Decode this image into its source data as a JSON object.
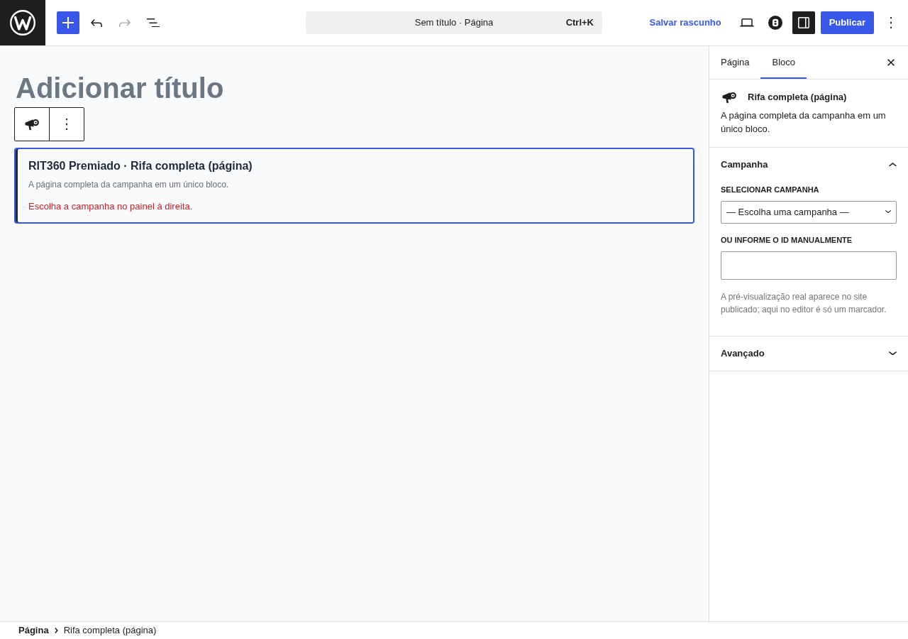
{
  "header": {
    "tools": [
      {
        "kind": "add",
        "disabled": false
      },
      {
        "kind": "undo",
        "disabled": false
      },
      {
        "kind": "redo",
        "disabled": true
      },
      {
        "kind": "list_view",
        "disabled": false
      }
    ],
    "command_bar": {
      "title": "Sem título · Página",
      "shortcut": "Ctrl+K"
    },
    "save_draft": "Salvar rascunho",
    "actions": [
      {
        "kind": "preview",
        "pressed": false
      },
      {
        "kind": "plugin",
        "pressed": false
      },
      {
        "kind": "settings",
        "pressed": true
      }
    ],
    "publish": "Publicar"
  },
  "editor": {
    "title": {
      "placeholder": "Adicionar título"
    },
    "block": {
      "selected": true,
      "title": "RIT360 Premiado · Rifa completa (página)",
      "description": "A página completa da campanha em um único bloco.",
      "notice": "Escolha a campanha no painel à direita."
    }
  },
  "sidebar": {
    "tabs": [
      {
        "label": "Página",
        "selected": false
      },
      {
        "label": "Bloco",
        "selected": true
      }
    ],
    "block_card": {
      "title": "Rifa completa (página)",
      "description": "A página completa da campanha em um único bloco."
    },
    "panels": [
      {
        "title": "Campanha",
        "expanded": true,
        "fields": [
          {
            "kind": "select",
            "label": "SELECIONAR CAMPANHA",
            "value": "— Escolha uma campanha —"
          },
          {
            "kind": "text",
            "label": "OU INFORME O ID MANUALMENTE"
          }
        ],
        "help": "A pré-visualização real aparece no site publicado; aqui no editor é só um marcador."
      },
      {
        "title": "Avançado",
        "expanded": false
      }
    ]
  },
  "breadcrumb": [
    "Página",
    "Rifa completa (página)"
  ]
}
